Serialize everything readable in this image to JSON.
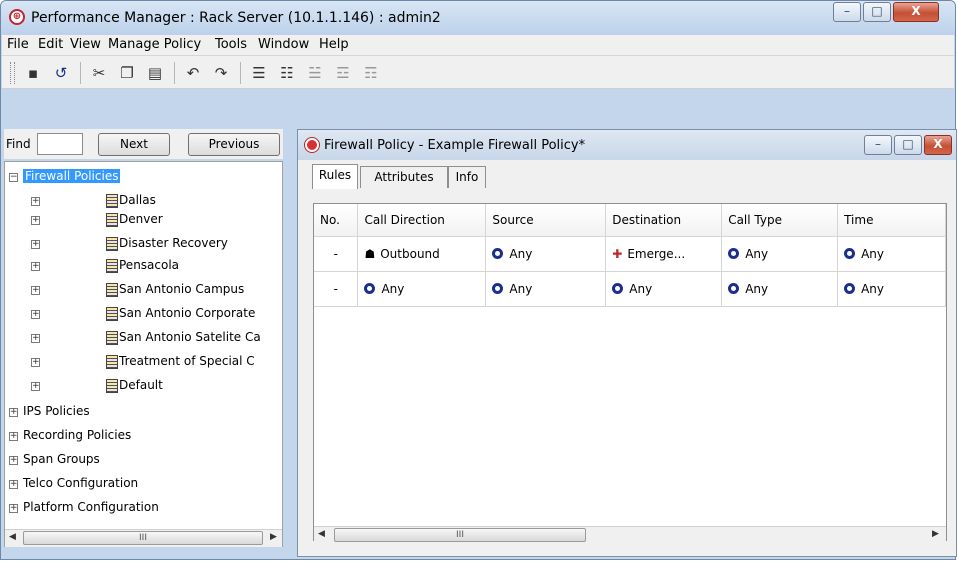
{
  "window": {
    "title": "Performance Manager : Rack Server (10.1.1.146) : admin2",
    "minimize": "–",
    "maximize": "□",
    "close": "X"
  },
  "menu": [
    "File",
    "Edit",
    "View",
    "Manage Policy",
    "Tools",
    "Window",
    "Help"
  ],
  "find": {
    "label": "Find",
    "value": "",
    "next_label": "Next",
    "previous_label": "Previous"
  },
  "tree": {
    "root": "Firewall Policies",
    "policies": [
      "Dallas",
      "Denver",
      "Disaster Recovery",
      "Pensacola",
      "San Antonio Campus",
      "San Antonio Corporate",
      "San Antonio Satelite Ca",
      "Treatment of Special C",
      "Default"
    ],
    "groups": [
      "IPS Policies",
      "Recording Policies",
      "Span Groups",
      "Telco Configuration",
      "Platform Configuration"
    ]
  },
  "scroll_grip": "III",
  "policy_frame": {
    "title": "Firewall Policy - Example Firewall Policy*",
    "tabs": [
      "Rules",
      "Attributes",
      "Info"
    ],
    "columns": [
      "No.",
      "Call Direction",
      "Source",
      "Destination",
      "Call Type",
      "Time"
    ],
    "rows": [
      [
        "-",
        "Outbound",
        "Any",
        "Emerge...",
        "Any",
        "Any"
      ],
      [
        "-",
        "Any",
        "Any",
        "Any",
        "Any",
        "Any"
      ]
    ]
  },
  "colors": {
    "title_bar": "#c7d6e9",
    "selected_item": "#3399ff",
    "any_icon": "#1b2f8a",
    "close_button": "#c45036"
  }
}
